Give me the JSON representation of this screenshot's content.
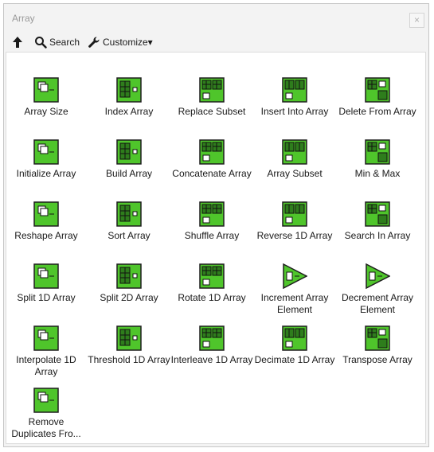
{
  "window": {
    "title": "Array",
    "close_glyph": "×"
  },
  "toolbar": {
    "up_icon": "up-arrow-icon",
    "search_label": "Search",
    "customize_label": "Customize▾"
  },
  "palette": {
    "items": [
      {
        "label": "Array Size",
        "icon": "array-size-icon"
      },
      {
        "label": "Index Array",
        "icon": "index-array-icon"
      },
      {
        "label": "Replace Subset",
        "icon": "replace-subset-icon"
      },
      {
        "label": "Insert Into Array",
        "icon": "insert-into-array-icon"
      },
      {
        "label": "Delete From Array",
        "icon": "delete-from-array-icon"
      },
      {
        "label": "Initialize Array",
        "icon": "initialize-array-icon"
      },
      {
        "label": "Build Array",
        "icon": "build-array-icon"
      },
      {
        "label": "Concatenate Array",
        "icon": "concatenate-array-icon"
      },
      {
        "label": "Array Subset",
        "icon": "array-subset-icon"
      },
      {
        "label": "Min & Max",
        "icon": "min-max-icon"
      },
      {
        "label": "Reshape Array",
        "icon": "reshape-array-icon"
      },
      {
        "label": "Sort Array",
        "icon": "sort-array-icon"
      },
      {
        "label": "Shuffle Array",
        "icon": "shuffle-array-icon"
      },
      {
        "label": "Reverse 1D Array",
        "icon": "reverse-1d-array-icon"
      },
      {
        "label": "Search In Array",
        "icon": "search-in-array-icon"
      },
      {
        "label": "Split 1D Array",
        "icon": "split-1d-array-icon"
      },
      {
        "label": "Split 2D Array",
        "icon": "split-2d-array-icon"
      },
      {
        "label": "Rotate 1D Array",
        "icon": "rotate-1d-array-icon"
      },
      {
        "label": "Increment Array Element",
        "icon": "increment-array-element-icon"
      },
      {
        "label": "Decrement Array Element",
        "icon": "decrement-array-element-icon"
      },
      {
        "label": "Interpolate 1D Array",
        "icon": "interpolate-1d-array-icon"
      },
      {
        "label": "Threshold 1D Array",
        "icon": "threshold-1d-array-icon"
      },
      {
        "label": "Interleave 1D Array",
        "icon": "interleave-1d-array-icon"
      },
      {
        "label": "Decimate 1D Array",
        "icon": "decimate-1d-array-icon"
      },
      {
        "label": "Transpose Array",
        "icon": "transpose-array-icon"
      },
      {
        "label": "Remove Duplicates Fro...",
        "icon": "remove-duplicates-icon"
      }
    ]
  },
  "colors": {
    "icon_green": "#4fc52b",
    "icon_dark_green": "#2e7d1c",
    "icon_border": "#1e1e1e"
  }
}
